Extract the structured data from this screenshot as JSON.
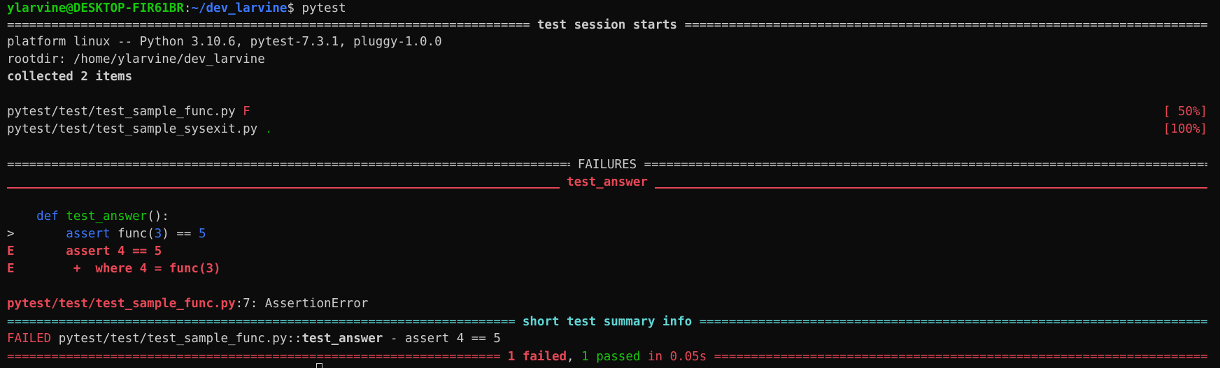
{
  "prompt": {
    "user_host": "ylarvine@DESKTOP-FIR61BR",
    "sep": ":",
    "path": "~/dev_larvine",
    "symbol": "$ ",
    "command": "pytest"
  },
  "session_header": {
    "title": " test session starts "
  },
  "info": {
    "platform": "platform linux -- Python 3.10.6, pytest-7.3.1, pluggy-1.0.0",
    "rootdir": "rootdir: /home/ylarvine/dev_larvine",
    "collected": "collected 2 items"
  },
  "results": [
    {
      "file": "pytest/test/test_sample_func.py ",
      "status": "F",
      "progress": "[ 50%]"
    },
    {
      "file": "pytest/test/test_sample_sysexit.py ",
      "status": ".",
      "progress": "[100%]"
    }
  ],
  "failures_header": {
    "title": " FAILURES "
  },
  "test_header": {
    "title": " test_answer "
  },
  "code": {
    "def_kw": "def ",
    "def_name": "test_answer",
    "def_rest": "():",
    "assert_prefix": ">       ",
    "assert_kw": "assert ",
    "assert_call": "func(",
    "assert_arg": "3",
    "assert_mid": ") == ",
    "assert_val": "5",
    "e1_prefix": "E       ",
    "e1_text": "assert 4 == 5",
    "e2_prefix": "E        ",
    "e2_text": "+  where 4 = func(3)"
  },
  "error_location": {
    "file": "pytest/test/test_sample_func.py",
    "rest": ":7: AssertionError"
  },
  "summary_header": {
    "title": " short test summary info "
  },
  "failed_line": {
    "label": "FAILED ",
    "path": "pytest/test/test_sample_func.py::",
    "test": "test_answer",
    "rest": " - assert 4 == 5"
  },
  "final": {
    "failed": "1 failed",
    "comma": ", ",
    "passed": "1 passed",
    "time": " in 0.05s"
  },
  "colors": {
    "background": "#0c0c0c",
    "text": "#cccccc",
    "green": "#16c60c",
    "blue": "#3b78ff",
    "red": "#e74856",
    "cyan": "#61d6d6"
  }
}
